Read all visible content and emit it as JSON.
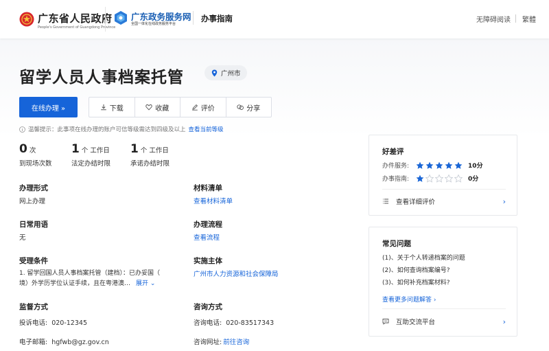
{
  "header": {
    "gov_name": "广东省人民政府",
    "gov_name_en": "People's Government of Guangdong Province",
    "service_name": "广东政务服务网",
    "service_sub": "全国一体化在线政务服务平台",
    "guide_label": "办事指南",
    "accessibility_label": "无障碍阅读",
    "traditional_label": "繁體"
  },
  "page": {
    "title": "留学人员人事档案托管",
    "location": "广州市"
  },
  "actions": {
    "online_label": "在线办理 »",
    "download_label": "下载",
    "favorite_label": "收藏",
    "review_label": "评价",
    "share_label": "分享"
  },
  "tip": {
    "text": "温馨提示：此事项在线办理的账户可信等级需达到四级及以上",
    "link": "查看当前等级"
  },
  "stats": [
    {
      "num": "0",
      "unit": "次",
      "label": "到现场次数"
    },
    {
      "num": "1",
      "unit": "个 工作日",
      "label": "法定办结时限"
    },
    {
      "num": "1",
      "unit": "个 工作日",
      "label": "承诺办结时限"
    }
  ],
  "fields": {
    "mode_title": "办理形式",
    "mode_value": "网上办理",
    "materials_title": "材料清单",
    "materials_link": "查看材料清单",
    "terms_title": "日常用语",
    "terms_value": "无",
    "process_title": "办理流程",
    "process_link": "查看流程",
    "conditions_title": "受理条件",
    "conditions_line1": "1. 留学回国人员人事档案托管（建档）：已办妥国（",
    "conditions_line2": "境）外学历学位认证手续，且在粤港澳…",
    "expand_label": "展开 ⌄",
    "subject_title": "实施主体",
    "subject_value": "广州市人力资源和社会保障局",
    "supervision_title": "监督方式",
    "complaint_label": "投诉电话:",
    "complaint_value": "020-12345",
    "email_label": "电子邮箱:",
    "email_value": "hgfwb@gz.gov.cn",
    "consult_title": "咨询方式",
    "consult_phone_label": "咨询电话:",
    "consult_phone_value": "020-83517343",
    "consult_web_label": "咨询网址:",
    "consult_web_link": "前往咨询"
  },
  "rating": {
    "title": "好差评",
    "service_label": "办件服务:",
    "service_score": "10分",
    "service_stars": 5,
    "guide_label": "办事指南:",
    "guide_score": "0分",
    "guide_stars": 1,
    "detail_label": "查看详细评价"
  },
  "faq": {
    "title": "常见问题",
    "items": [
      "(1)、关于个人转递档案的问题",
      "(2)、如何查询档案编号?",
      "(3)、如何补充档案材料?"
    ],
    "more_label": "查看更多问题解答 ›",
    "platform_label": "互助交流平台"
  },
  "colors": {
    "primary": "#1664d9",
    "star": "#1a66d6",
    "star_empty": "#c9ced6"
  }
}
